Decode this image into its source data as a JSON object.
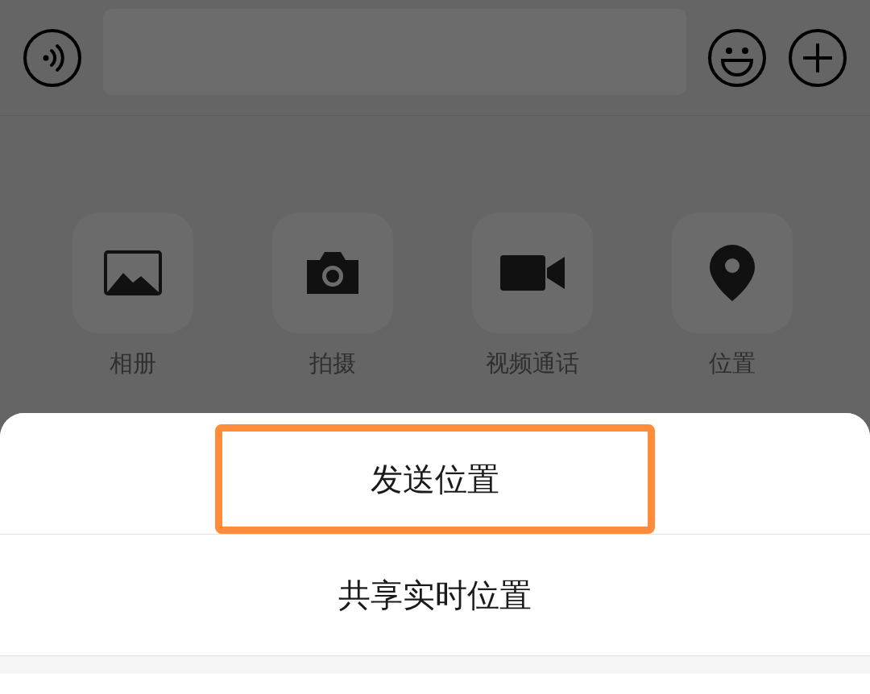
{
  "input_bar": {
    "buttons": [
      {
        "kind": "voice"
      },
      {
        "kind": "emoji"
      },
      {
        "kind": "plus"
      }
    ]
  },
  "panel": {
    "items": [
      {
        "kind": "album",
        "label": "相册"
      },
      {
        "kind": "camera",
        "label": "拍摄"
      },
      {
        "kind": "video",
        "label": "视频通话"
      },
      {
        "kind": "location",
        "label": "位置"
      }
    ]
  },
  "action_sheet": {
    "options": [
      {
        "label": "发送位置",
        "highlighted": true
      },
      {
        "label": "共享实时位置",
        "highlighted": false
      }
    ]
  }
}
